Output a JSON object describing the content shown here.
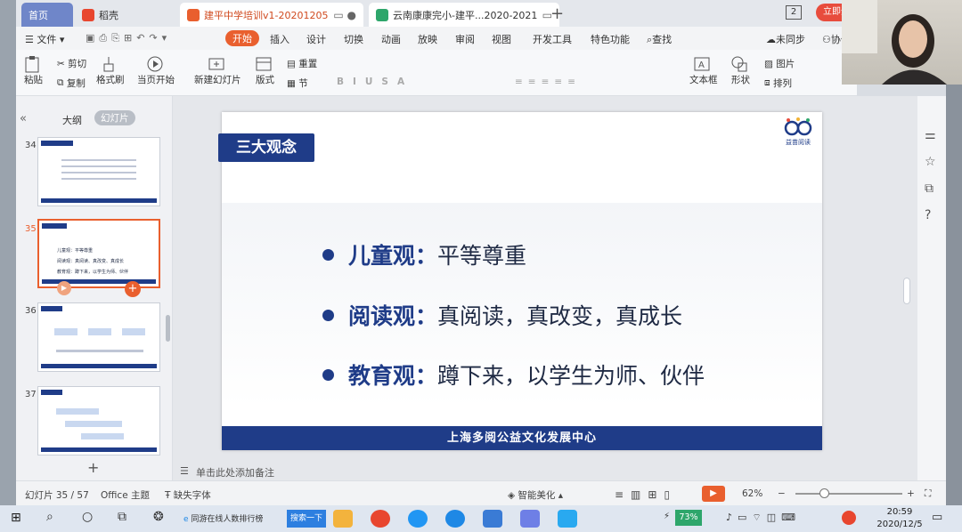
{
  "tabs": [
    {
      "label": "首页"
    },
    {
      "label": "稻壳"
    },
    {
      "label": "建平中学培训v1-20201205"
    },
    {
      "label": "云南康康完小-建平...2020-2021"
    }
  ],
  "window_count": "2",
  "login_label": "立即登录",
  "menu": {
    "file": "文件",
    "start": "开始",
    "insert": "插入",
    "design": "设计",
    "switch": "切换",
    "animation": "动画",
    "show": "放映",
    "review": "审阅",
    "view": "视图",
    "dev": "开发工具",
    "special": "特色功能",
    "search": "查找",
    "sync": "未同步",
    "collab": "协作"
  },
  "ribbon": {
    "paste": "粘贴",
    "cut": "剪切",
    "copy": "复制",
    "format_brush": "格式刷",
    "from_current": "当页开始",
    "new_slide": "新建幻灯片",
    "layout": "版式",
    "section": "节",
    "reset": "重置",
    "textbox": "文本框",
    "shape": "形状",
    "arrange": "排列",
    "picture": "图片"
  },
  "left_panel": {
    "outline_tab": "大纲",
    "slides_tab": "幻灯片",
    "thumbs": [
      {
        "num": "34"
      },
      {
        "num": "35"
      },
      {
        "num": "36"
      },
      {
        "num": "37"
      }
    ],
    "thumb35_lines": [
      "儿童观：平等尊重",
      "阅读观：真阅读、真改变、真成长",
      "教育观：蹲下来，以学生为师、伙伴"
    ],
    "add_slide": "+"
  },
  "slide": {
    "title": "三大观念",
    "bullets": [
      {
        "key": "儿童观：",
        "value": "平等尊重"
      },
      {
        "key": "阅读观：",
        "value": "真阅读，真改变，真成长"
      },
      {
        "key": "教育观：",
        "value": "蹲下来，以学生为师、伙伴"
      }
    ],
    "footer": "上海多阅公益文化发展中心",
    "logo_text": "益苗阅读"
  },
  "notes_placeholder": "单击此处添加备注",
  "status": {
    "slide_count": "幻灯片 35 / 57",
    "theme": "Office 主题",
    "missing_font": "缺失字体",
    "beautify": "智能美化",
    "zoom": "62%"
  },
  "taskbar": {
    "search_item": "同游在线人数排行榜",
    "search_btn": "搜索一下",
    "battery": "73%",
    "time": "20:59",
    "date": "2020/12/5"
  },
  "colors": {
    "slide_navy": "#1f3c88",
    "accent_orange": "#e95f2e"
  }
}
